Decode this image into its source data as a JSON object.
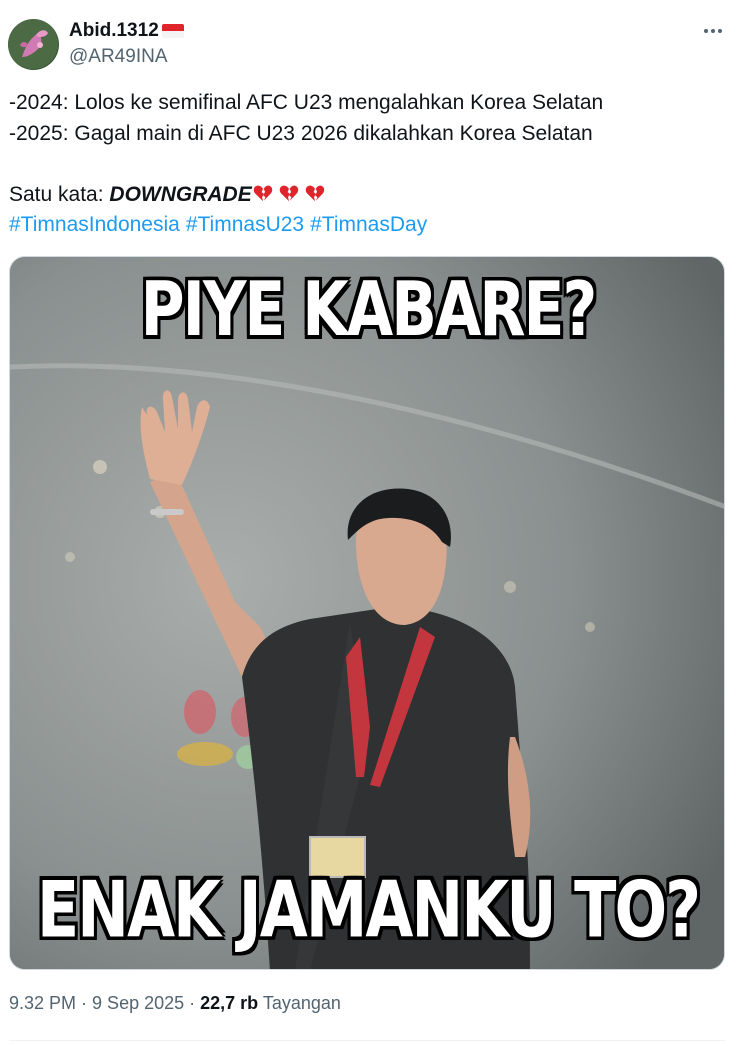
{
  "author": {
    "display_name": "Abid.1312",
    "handle": "@AR49INA",
    "flag": "indonesia-flag-icon"
  },
  "tweet": {
    "lines": [
      "-2024: Lolos ke semifinal AFC U23 mengalahkan Korea Selatan",
      "-2025: Gagal main di AFC U23 2026 dikalahkan Korea Selatan"
    ],
    "summary_prefix": "Satu kata: ",
    "summary_bold": "DOWNGRADE",
    "emojis": [
      "broken-heart-icon",
      "broken-heart-icon",
      "broken-heart-icon"
    ],
    "hashtags": [
      "#TimnasIndonesia",
      "#TimnasU23",
      "#TimnasDay"
    ]
  },
  "media": {
    "caption_top": "PIYE KABARE?",
    "caption_bottom": "ENAK JAMANKU TO?"
  },
  "meta": {
    "time": "9.32 PM",
    "separator": " · ",
    "date": "9 Sep 2025",
    "views_count": "22,7 rb",
    "views_label": " Tayangan"
  },
  "colors": {
    "link": "#1d9bf0",
    "secondary_text": "#536471",
    "heart": "#e0242b"
  }
}
